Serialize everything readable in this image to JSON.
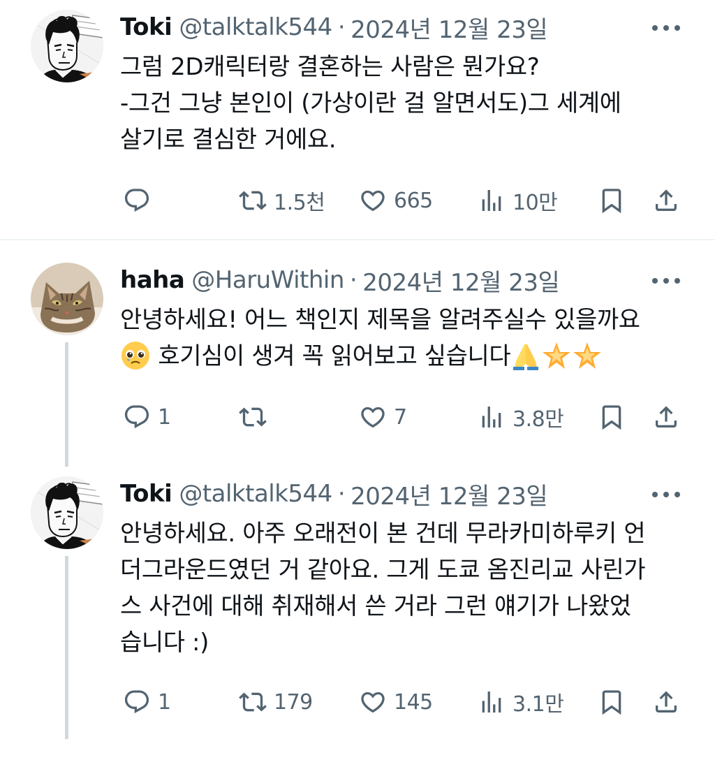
{
  "colors": {
    "text": "#0f1419",
    "muted": "#536471",
    "divider": "#eff3f4",
    "thread_line": "#cfd9de"
  },
  "tweets": [
    {
      "name": "Toki",
      "handle": "@talktalk544",
      "separator": "·",
      "date": "2024년 12월 23일",
      "avatar_icon": "manga-character-avatar",
      "lines": [
        "그럼 2D캐릭터랑 결혼하는 사람은 뭔가요?",
        "-그건 그냥 본인이 (가상이란 걸 알면서도)그 세계에",
        "살기로 결심한 거에요."
      ],
      "stats": {
        "replies": "",
        "reposts": "1.5천",
        "likes": "665",
        "views": "10만"
      }
    },
    {
      "name": "haha",
      "handle": "@HaruWithin",
      "separator": "·",
      "date": "2024년 12월 23일",
      "avatar_icon": "cat-avatar",
      "lines": [
        "안녕하세요! 어느 책인지 제목을 알려주실수 있을까요",
        "호기심이 생겨 꼭 읽어보고 싶습니다"
      ],
      "emojis": [
        "pleading-face-emoji",
        "folded-hands-emoji",
        "glowing-star-emoji",
        "glowing-star-emoji"
      ],
      "stats": {
        "replies": "1",
        "reposts": "",
        "likes": "7",
        "views": "3.8만"
      }
    },
    {
      "name": "Toki",
      "handle": "@talktalk544",
      "separator": "·",
      "date": "2024년 12월 23일",
      "avatar_icon": "manga-character-avatar",
      "lines": [
        "안녕하세요. 아주 오래전이 본 건데 무라카미하루키 언",
        "더그라운드였던 거 같아요. 그게 도쿄 옴진리교 사린가",
        "스 사건에 대해 취재해서 쓴 거라 그런 얘기가 나왔었",
        "습니다 :)"
      ],
      "stats": {
        "replies": "1",
        "reposts": "179",
        "likes": "145",
        "views": "3.1만"
      }
    }
  ]
}
